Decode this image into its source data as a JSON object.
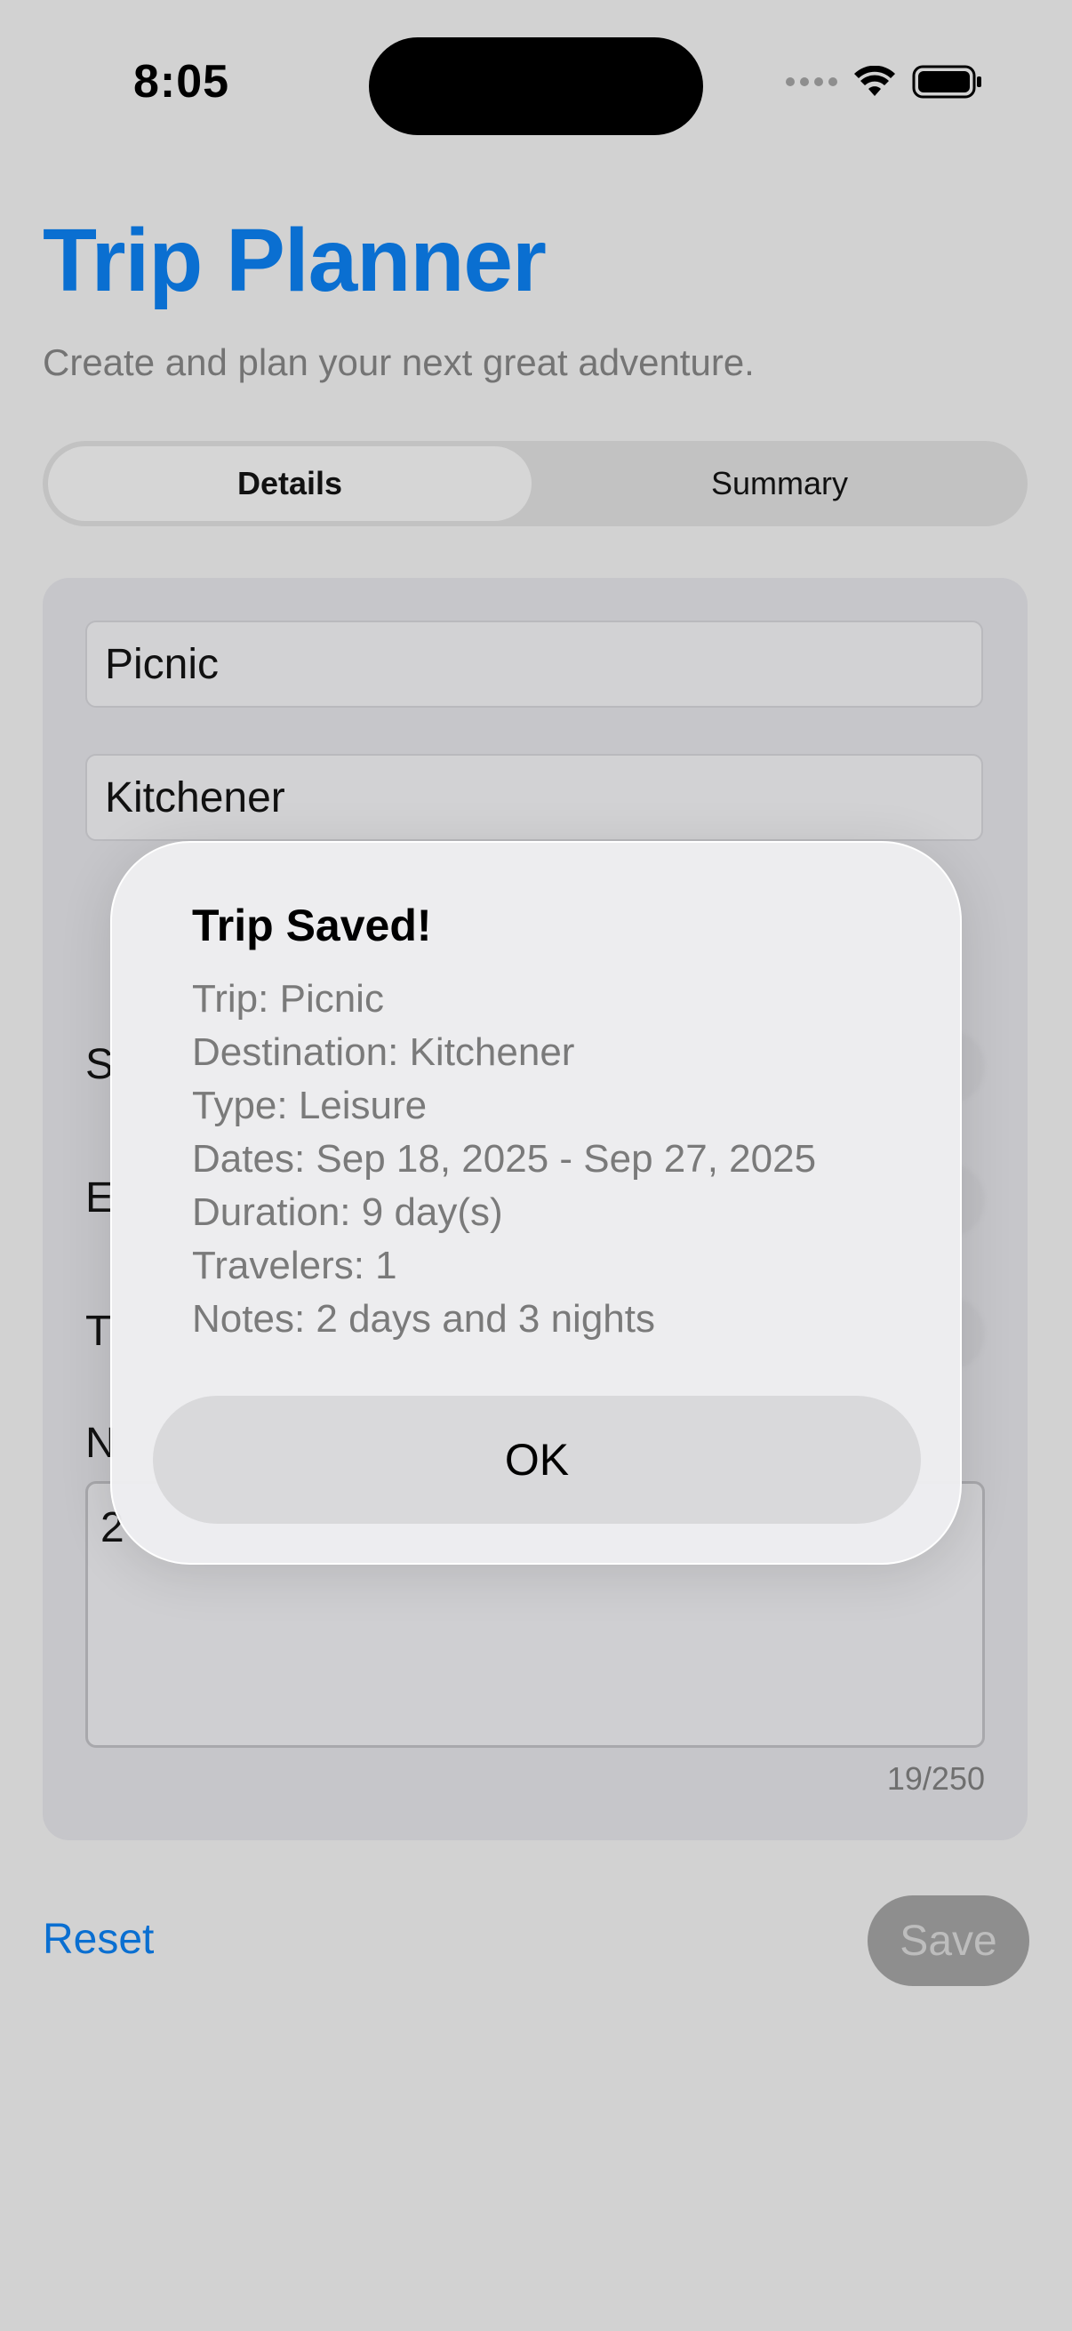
{
  "status_bar": {
    "time": "8:05"
  },
  "header": {
    "title": "Trip Planner",
    "subtitle": "Create and plan your next great adventure."
  },
  "tabs": [
    {
      "label": "Details",
      "selected": true
    },
    {
      "label": "Summary",
      "selected": false
    }
  ],
  "form": {
    "trip_name": "Picnic",
    "destination": "Kitchener",
    "start_label_partial": "S",
    "end_label_partial": "E",
    "type_label_partial": "T",
    "notes_label_partial": "N",
    "notes_value_partial": "2",
    "notes_counter": "19/250"
  },
  "actions": {
    "reset_label": "Reset",
    "save_label": "Save"
  },
  "alert": {
    "title": "Trip Saved!",
    "lines": [
      "Trip: Picnic",
      "Destination: Kitchener",
      "Type: Leisure",
      "Dates: Sep 18, 2025 - Sep 27, 2025",
      "Duration: 9 day(s)",
      "Travelers: 1",
      "Notes: 2 days and 3 nights"
    ],
    "ok_label": "OK"
  },
  "colors": {
    "accent": "#0a6fd1",
    "background": "#d2d2d2",
    "save_button": "#8e8e8e"
  }
}
